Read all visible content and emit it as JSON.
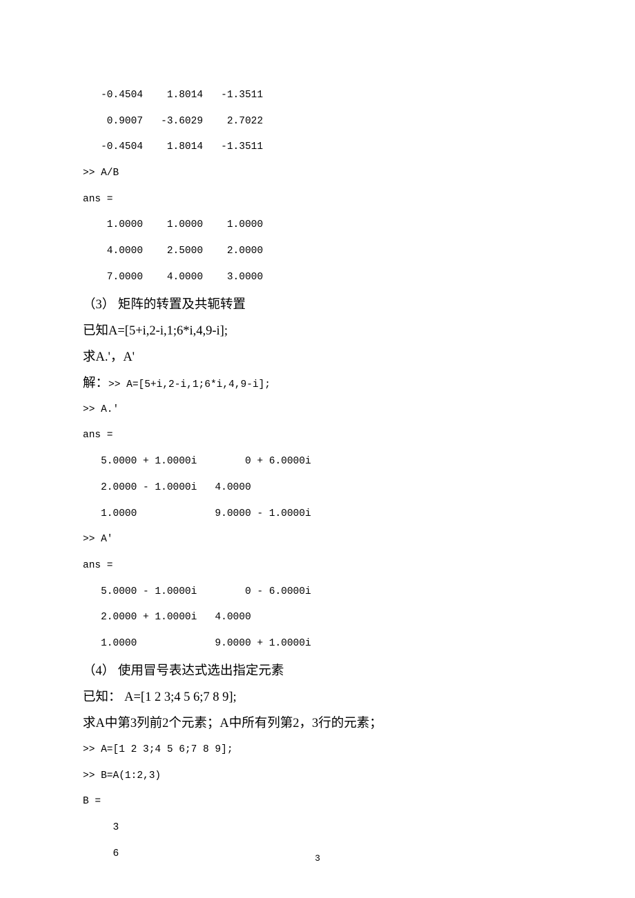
{
  "block1": "   -0.4504    1.8014   -1.3511\n    0.9007   -3.6029    2.7022\n   -0.4504    1.8014   -1.3511\n>> A/B\nans =\n    1.0000    1.0000    1.0000\n    4.0000    2.5000    2.0000\n    7.0000    4.0000    3.0000",
  "s3_title": "（3） 矩阵的转置及共轭转置",
  "s3_known": "已知A=[5+i,2-i,1;6*i,4,9-i];",
  "s3_req": "求A.'，A'",
  "s3_solve_prefix": "解：",
  "s3_solve_code": ">> A=[5+i,2-i,1;6*i,4,9-i];",
  "block2": ">> A.'\nans =\n   5.0000 + 1.0000i        0 + 6.0000i\n   2.0000 - 1.0000i   4.0000          \n   1.0000             9.0000 - 1.0000i\n>> A'\nans =\n   5.0000 - 1.0000i        0 - 6.0000i\n   2.0000 + 1.0000i   4.0000          \n   1.0000             9.0000 + 1.0000i",
  "s4_title": "（4） 使用冒号表达式选出指定元素",
  "s4_known": "已知： A=[1 2 3;4 5 6;7 8 9];",
  "s4_req": "求A中第3列前2个元素；A中所有列第2，3行的元素；",
  "block3": ">> A=[1 2 3;4 5 6;7 8 9];\n>> B=A(1:2,3)\nB =\n     3\n     6",
  "page_number": "3"
}
